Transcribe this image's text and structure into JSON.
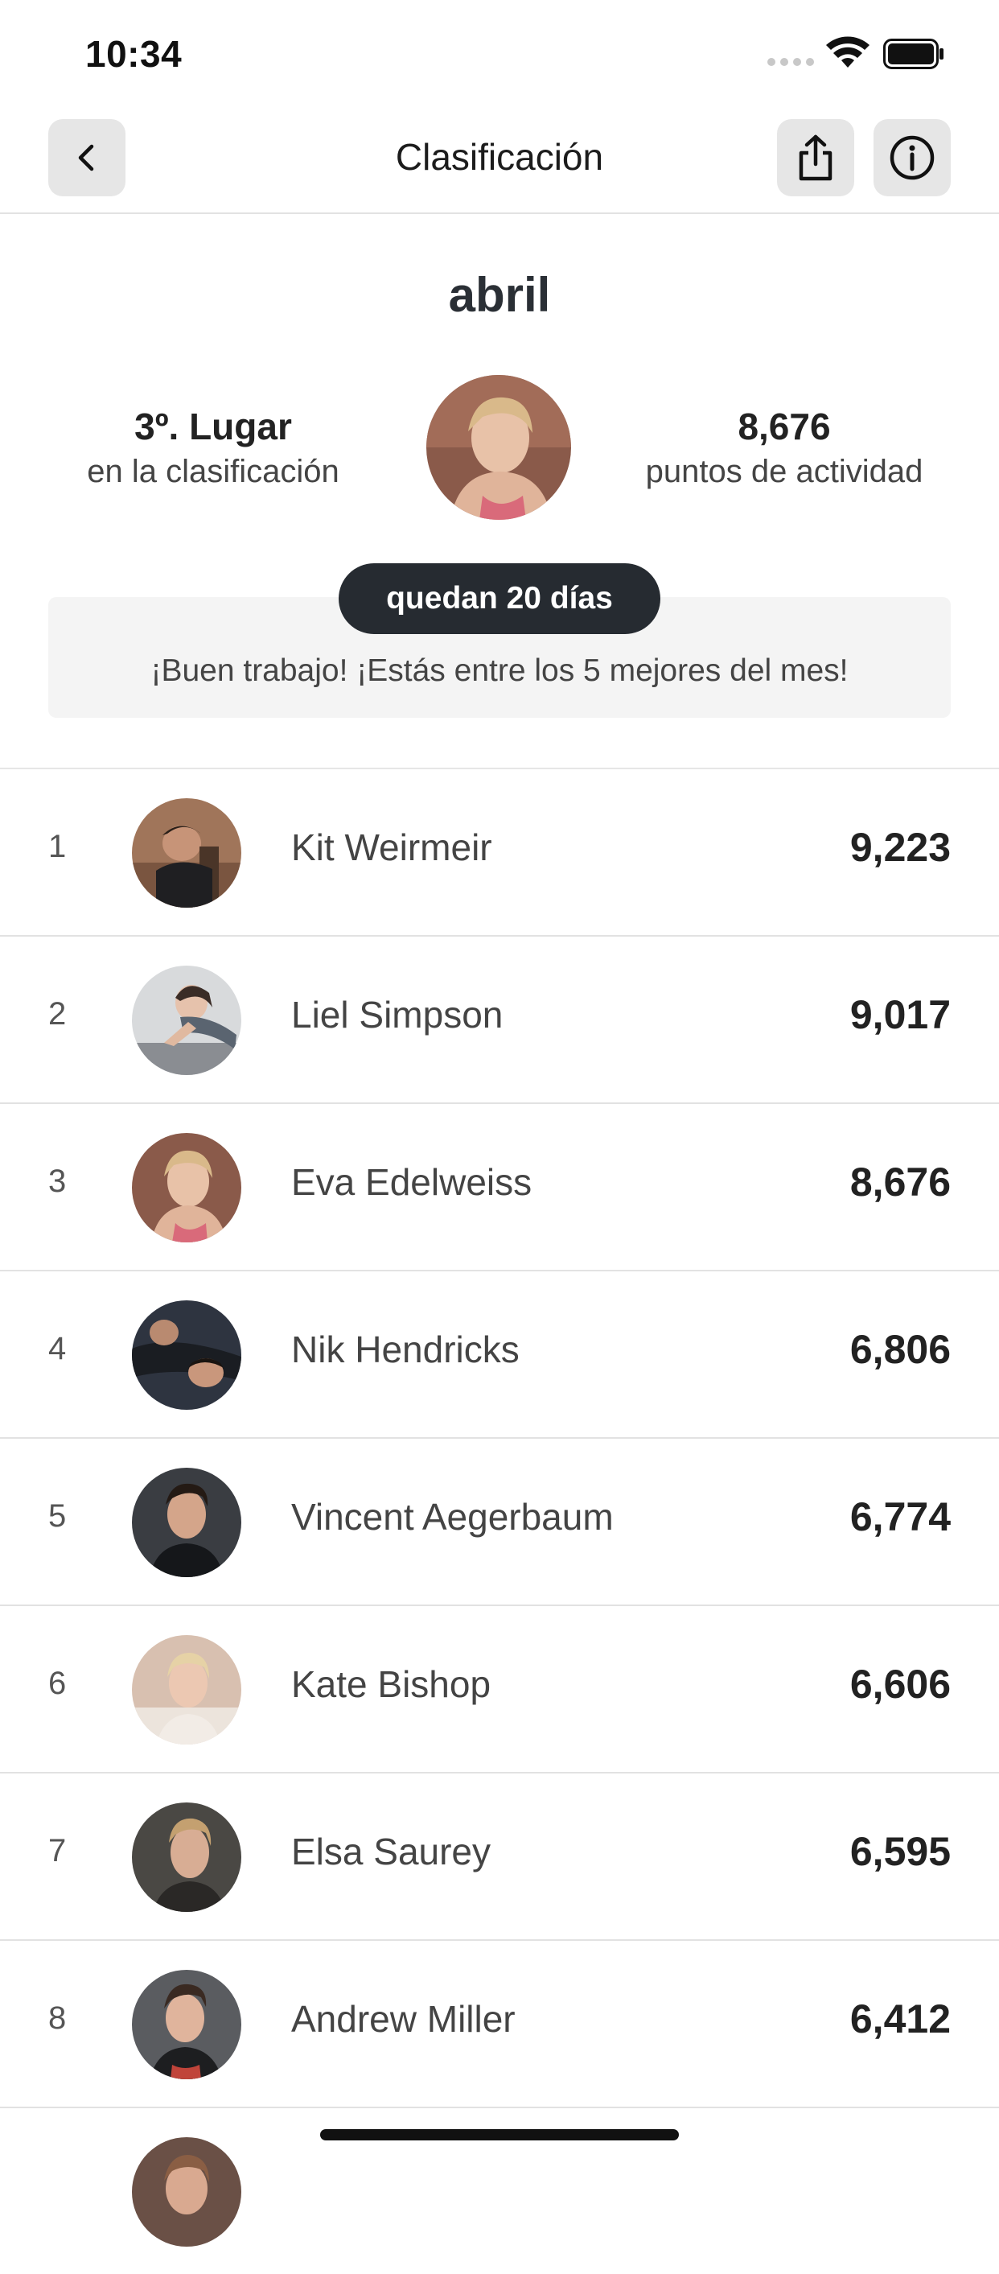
{
  "status_bar": {
    "time": "10:34"
  },
  "nav": {
    "title": "Clasificación"
  },
  "header": {
    "month": "abril",
    "place_value": "3º. Lugar",
    "place_caption": "en la clasificación",
    "points_value": "8,676",
    "points_caption": "puntos de actividad",
    "days_left": "quedan 20 días",
    "message": "¡Buen trabajo! ¡Estás entre los 5 mejores del mes!"
  },
  "leaderboard": [
    {
      "rank": "1",
      "name": "Kit Weirmeir",
      "score": "9,223"
    },
    {
      "rank": "2",
      "name": "Liel Simpson",
      "score": "9,017"
    },
    {
      "rank": "3",
      "name": "Eva Edelweiss",
      "score": "8,676"
    },
    {
      "rank": "4",
      "name": "Nik Hendricks",
      "score": "6,806"
    },
    {
      "rank": "5",
      "name": "Vincent Aegerbaum",
      "score": "6,774"
    },
    {
      "rank": "6",
      "name": "Kate Bishop",
      "score": "6,606"
    },
    {
      "rank": "7",
      "name": "Elsa Saurey",
      "score": "6,595"
    },
    {
      "rank": "8",
      "name": "Andrew Miller",
      "score": "6,412"
    }
  ],
  "icons": {
    "back": "chevron-left-icon",
    "share": "share-icon",
    "info": "info-icon"
  },
  "colors": {
    "pill_background": "#262b31",
    "button_background": "#e6e6e6",
    "banner_background": "#f4f4f4"
  }
}
